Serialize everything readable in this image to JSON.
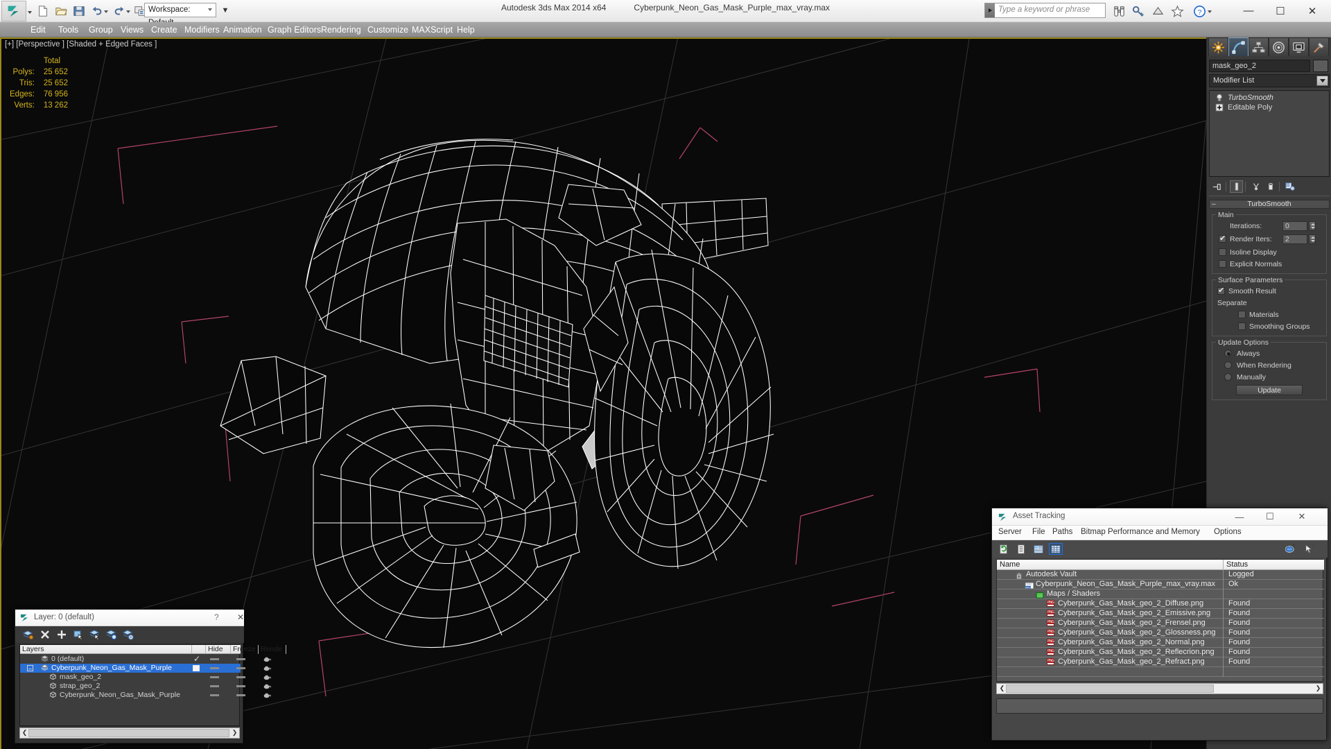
{
  "titlebar": {
    "workspace_label": "Workspace: Default",
    "app_title": "Autodesk 3ds Max  2014 x64",
    "file_name": "Cyberpunk_Neon_Gas_Mask_Purple_max_vray.max",
    "search_placeholder": "Type a keyword or phrase",
    "quick_access": [
      "new-icon",
      "open-icon",
      "save-icon",
      "undo-icon",
      "redo-icon",
      "setproject-icon"
    ],
    "right_icons": [
      "binoculars-icon",
      "key-icon",
      "satellite-icon",
      "star-icon",
      "help-icon"
    ],
    "window_buttons": [
      "minimize",
      "maximize",
      "close"
    ]
  },
  "menubar": {
    "items": [
      "Edit",
      "Tools",
      "Group",
      "Views",
      "Create",
      "Modifiers",
      "Animation",
      "Graph Editors",
      "Rendering",
      "Customize",
      "MAXScript",
      "Help"
    ]
  },
  "viewport": {
    "label": "[+] [Perspective ] [Shaded + Edged Faces ]",
    "stats": {
      "header": "Total",
      "rows": [
        {
          "label": "Polys:",
          "value": "25 652"
        },
        {
          "label": "Tris:",
          "value": "25 652"
        },
        {
          "label": "Edges:",
          "value": "76 956"
        },
        {
          "label": "Verts:",
          "value": "13 262"
        }
      ]
    },
    "colors": {
      "background": "#0a0a0a",
      "wireframe": "#ffffff",
      "grid": "#3a3a3a",
      "axis": "#a04a66",
      "stats_text": "#d4b41e"
    }
  },
  "command_panel": {
    "tabs": [
      "create-tab-icon",
      "modify-tab-icon",
      "hierarchy-tab-icon",
      "motion-tab-icon",
      "display-tab-icon",
      "utilities-tab-icon"
    ],
    "active_tab_index": 1,
    "object_name": "mask_geo_2",
    "modifier_list_label": "Modifier List",
    "stack": [
      {
        "label": "TurboSmooth",
        "icon": "lightbulb-icon",
        "italic": true
      },
      {
        "label": "Editable Poly",
        "icon": "plus-box-icon",
        "italic": false
      }
    ],
    "stack_toolbar": [
      "pin-stack-icon",
      "show-end-result-icon",
      "make-unique-icon",
      "remove-modifier-icon",
      "configure-sets-icon"
    ],
    "rollout": {
      "title": "TurboSmooth",
      "main_group": "Main",
      "iterations_label": "Iterations:",
      "iterations_value": "0",
      "render_iters_label": "Render Iters:",
      "render_iters_value": "2",
      "render_iters_checked": true,
      "isoline_label": "Isoline Display",
      "isoline_checked": false,
      "explicit_label": "Explicit Normals",
      "explicit_checked": false,
      "surface_group": "Surface Parameters",
      "smooth_result_label": "Smooth Result",
      "smooth_result_checked": true,
      "separate_label": "Separate",
      "materials_label": "Materials",
      "materials_checked": false,
      "smoothing_groups_label": "Smoothing Groups",
      "smoothing_groups_checked": false,
      "update_group": "Update Options",
      "always_label": "Always",
      "when_rendering_label": "When Rendering",
      "manually_label": "Manually",
      "update_selected": "Always",
      "update_button": "Update"
    }
  },
  "layer_dialog": {
    "title": "Layer: 0 (default)",
    "help_glyph": "?",
    "close_glyph": "✕",
    "toolbar_icons": [
      "create-new-layer-icon",
      "delete-layer-icon",
      "add-layer-icon",
      "select-objects-in-layer-icon",
      "select-highlighted-objects-icon",
      "highlight-selected-objects-icon",
      "layer-properties-icon"
    ],
    "columns": [
      "Layers",
      "",
      "Hide",
      "Freeze",
      "Rende"
    ],
    "rows": [
      {
        "name": "0 (default)",
        "indent": 1,
        "icon": "layer-icon",
        "mark": "check",
        "selected": false,
        "hide": "dash",
        "freeze": "dash",
        "render": "teapot"
      },
      {
        "name": "Cyberpunk_Neon_Gas_Mask_Purple",
        "indent": 1,
        "icon": "layer-icon",
        "mark": "box",
        "selected": true,
        "expander": "minus",
        "hide": "dash",
        "freeze": "dash",
        "render": "teapot"
      },
      {
        "name": "mask_geo_2",
        "indent": 2,
        "icon": "object-icon",
        "mark": "",
        "selected": false,
        "hide": "dash",
        "freeze": "dash",
        "render": "teapot"
      },
      {
        "name": "strap_geo_2",
        "indent": 2,
        "icon": "object-icon",
        "mark": "",
        "selected": false,
        "hide": "dash",
        "freeze": "dash",
        "render": "teapot"
      },
      {
        "name": "Cyberpunk_Neon_Gas_Mask_Purple",
        "indent": 2,
        "icon": "object-icon",
        "mark": "",
        "selected": false,
        "hide": "dash",
        "freeze": "dash",
        "render": "teapot"
      }
    ]
  },
  "asset_tracking": {
    "title": "Asset Tracking",
    "window_buttons": [
      "—",
      "☐",
      "✕"
    ],
    "menu": [
      "Server",
      "File",
      "Paths",
      "Bitmap Performance and Memory",
      "Options"
    ],
    "toolbar_icons": [
      "refresh-icon",
      "list-view-icon",
      "detail-view-icon",
      "grid-view-icon",
      "help-globe-icon",
      "help-arrow-icon"
    ],
    "columns": [
      "Name",
      "Status"
    ],
    "rows": [
      {
        "name": "Autodesk Vault",
        "status": "Logged",
        "indent": 0,
        "icon": "vault-icon"
      },
      {
        "name": "Cyberpunk_Neon_Gas_Mask_Purple_max_vray.max",
        "status": "Ok",
        "indent": 1,
        "icon": "max-file-icon"
      },
      {
        "name": "Maps / Shaders",
        "status": "",
        "indent": 2,
        "icon": "maps-icon"
      },
      {
        "name": "Cyberpunk_Gas_Mask_geo_2_Diffuse.png",
        "status": "Found",
        "indent": 3,
        "icon": "png-icon"
      },
      {
        "name": "Cyberpunk_Gas_Mask_geo_2_Emissive.png",
        "status": "Found",
        "indent": 3,
        "icon": "png-icon"
      },
      {
        "name": "Cyberpunk_Gas_Mask_geo_2_Frensel.png",
        "status": "Found",
        "indent": 3,
        "icon": "png-icon"
      },
      {
        "name": "Cyberpunk_Gas_Mask_geo_2_Glossness.png",
        "status": "Found",
        "indent": 3,
        "icon": "png-icon"
      },
      {
        "name": "Cyberpunk_Gas_Mask_geo_2_Normal.png",
        "status": "Found",
        "indent": 3,
        "icon": "png-icon"
      },
      {
        "name": "Cyberpunk_Gas_Mask_geo_2_Reflecrion.png",
        "status": "Found",
        "indent": 3,
        "icon": "png-icon"
      },
      {
        "name": "Cyberpunk_Gas_Mask_geo_2_Refract.png",
        "status": "Found",
        "indent": 3,
        "icon": "png-icon"
      }
    ]
  }
}
